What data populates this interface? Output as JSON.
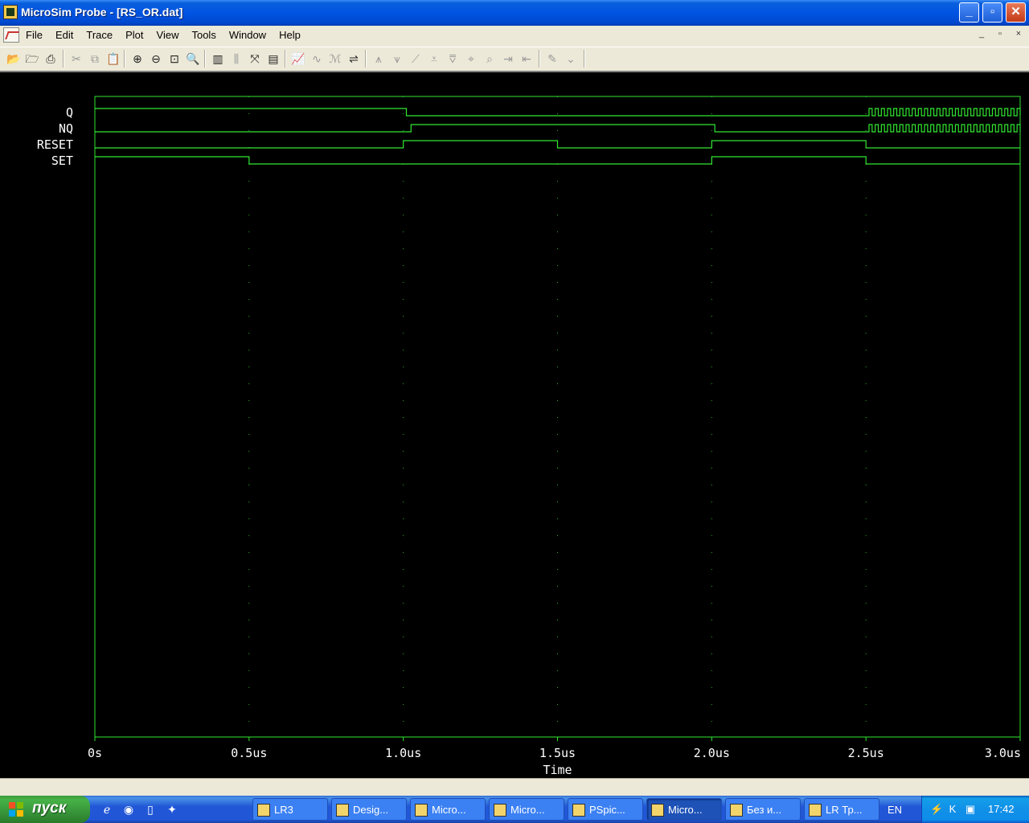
{
  "window": {
    "title": "MicroSim Probe - [RS_OR.dat]",
    "controls": {
      "minimize": "_",
      "maximize": "▫",
      "close": "✕"
    }
  },
  "menu": {
    "items": [
      "File",
      "Edit",
      "Trace",
      "Plot",
      "View",
      "Tools",
      "Window",
      "Help"
    ],
    "mdi_controls": [
      "_",
      "▫",
      "×"
    ]
  },
  "toolbar": {
    "buttons": [
      {
        "icon": "open-folder-icon",
        "glyph": "📂",
        "enabled": true
      },
      {
        "icon": "append-icon",
        "glyph": "🗁",
        "enabled": true
      },
      {
        "icon": "print-icon",
        "glyph": "⎙",
        "enabled": true
      },
      {
        "icon": "cut-icon",
        "glyph": "✂",
        "enabled": false
      },
      {
        "icon": "copy-icon",
        "glyph": "⧉",
        "enabled": false
      },
      {
        "icon": "paste-icon",
        "glyph": "📋",
        "enabled": false
      },
      {
        "icon": "zoom-in-icon",
        "glyph": "⊕",
        "enabled": true
      },
      {
        "icon": "zoom-out-icon",
        "glyph": "⊖",
        "enabled": true
      },
      {
        "icon": "zoom-area-icon",
        "glyph": "⊡",
        "enabled": true
      },
      {
        "icon": "zoom-fit-icon",
        "glyph": "🔍",
        "enabled": true
      },
      {
        "icon": "log-x-icon",
        "glyph": "▥",
        "enabled": true
      },
      {
        "icon": "fourier-icon",
        "glyph": "⫼",
        "enabled": false
      },
      {
        "icon": "performance-icon",
        "glyph": "⤧",
        "enabled": true
      },
      {
        "icon": "log-y-icon",
        "glyph": "▤",
        "enabled": true
      },
      {
        "icon": "add-trace-icon",
        "glyph": "📈",
        "enabled": true
      },
      {
        "icon": "eval-goal-icon",
        "glyph": "∿",
        "enabled": false
      },
      {
        "icon": "mark-data-icon",
        "glyph": "ℳ",
        "enabled": false
      },
      {
        "icon": "toggle-cursor-icon",
        "glyph": "⇌",
        "enabled": true
      },
      {
        "icon": "cursor-peak-icon",
        "glyph": "⩚",
        "enabled": false
      },
      {
        "icon": "cursor-trough-icon",
        "glyph": "⩛",
        "enabled": false
      },
      {
        "icon": "cursor-slope-icon",
        "glyph": "⟋",
        "enabled": false
      },
      {
        "icon": "cursor-min-icon",
        "glyph": "⩡",
        "enabled": false
      },
      {
        "icon": "cursor-max-icon",
        "glyph": "⩢",
        "enabled": false
      },
      {
        "icon": "cursor-point-icon",
        "glyph": "⌖",
        "enabled": false
      },
      {
        "icon": "cursor-search-icon",
        "glyph": "⌕",
        "enabled": false
      },
      {
        "icon": "cursor-next-transition-icon",
        "glyph": "⇥",
        "enabled": false
      },
      {
        "icon": "cursor-prev-transition-icon",
        "glyph": "⇤",
        "enabled": false
      },
      {
        "icon": "mark-label-icon",
        "glyph": "✎",
        "enabled": false
      },
      {
        "icon": "mark-point-icon",
        "glyph": "⌄",
        "enabled": false
      }
    ]
  },
  "chart_data": {
    "type": "digital-timing",
    "xlabel": "Time",
    "xlim": [
      0,
      3.0
    ],
    "x_unit": "us",
    "x_ticks": [
      "0s",
      "0.5us",
      "1.0us",
      "1.5us",
      "2.0us",
      "2.5us",
      "3.0us"
    ],
    "grid": "dotted-vertical",
    "trace_color": "#32e632",
    "series": [
      {
        "name": "Q",
        "edges": [
          [
            0,
            1
          ],
          [
            1.01,
            0
          ],
          [
            2.51,
            "osc"
          ]
        ],
        "osc_period": 0.02
      },
      {
        "name": "NQ",
        "edges": [
          [
            0,
            0
          ],
          [
            1.025,
            1
          ],
          [
            2.01,
            0
          ],
          [
            2.51,
            "osc"
          ]
        ],
        "osc_period": 0.02
      },
      {
        "name": "RESET",
        "edges": [
          [
            0,
            0
          ],
          [
            1.0,
            1
          ],
          [
            1.5,
            0
          ],
          [
            2.0,
            1
          ],
          [
            2.5,
            0
          ]
        ]
      },
      {
        "name": "SET",
        "edges": [
          [
            0,
            1
          ],
          [
            0.5,
            0
          ],
          [
            2.0,
            1
          ],
          [
            2.5,
            0
          ]
        ]
      }
    ]
  },
  "taskbar": {
    "start_label": "пуск",
    "quick_launch": [
      {
        "icon": "ie-icon",
        "glyph": "ℯ"
      },
      {
        "icon": "browser-icon",
        "glyph": "◉"
      },
      {
        "icon": "desktop-icon",
        "glyph": "▯"
      },
      {
        "icon": "tool-icon",
        "glyph": "✦"
      }
    ],
    "tasks": [
      {
        "label": "LR3",
        "icon": "folder-icon",
        "active": false
      },
      {
        "label": "Desig...",
        "icon": "design-icon",
        "active": false
      },
      {
        "label": "Micro...",
        "icon": "microsim-icon",
        "active": false
      },
      {
        "label": "Micro...",
        "icon": "microsim-edit-icon",
        "active": false
      },
      {
        "label": "PSpic...",
        "icon": "pspice-icon",
        "active": false
      },
      {
        "label": "Micro...",
        "icon": "probe-icon",
        "active": true
      },
      {
        "label": "Без и...",
        "icon": "document-icon",
        "active": false
      },
      {
        "label": "LR Тр...",
        "icon": "word-doc-icon",
        "active": false
      }
    ],
    "language": "EN",
    "tray_icons": [
      {
        "icon": "network-icon",
        "glyph": "⚡"
      },
      {
        "icon": "antivirus-icon",
        "glyph": "K"
      },
      {
        "icon": "monitor-icon",
        "glyph": "▣"
      }
    ],
    "clock": "17:42"
  }
}
